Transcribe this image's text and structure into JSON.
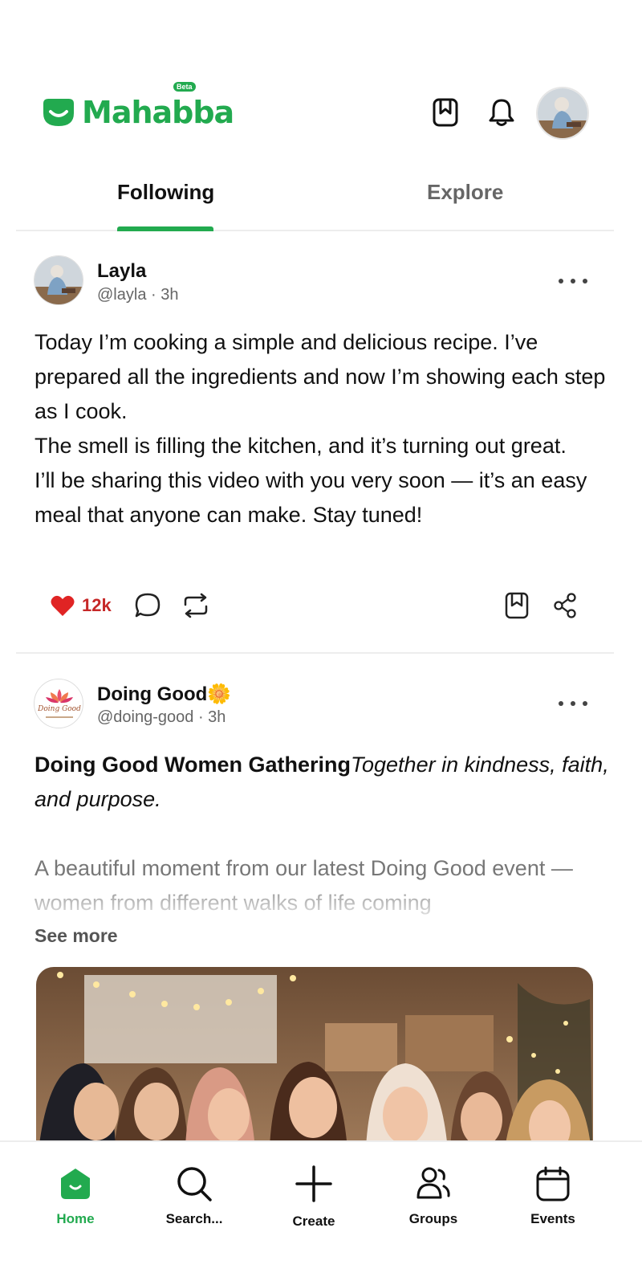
{
  "app": {
    "brand": "Mahabba",
    "badge": "Beta",
    "accent_color": "#22aa4f"
  },
  "header": {
    "icons": [
      "bookmark-icon",
      "bell-icon",
      "profile-avatar"
    ]
  },
  "tabs": [
    {
      "label": "Following",
      "active": true
    },
    {
      "label": "Explore",
      "active": false
    }
  ],
  "posts": [
    {
      "name": "Layla",
      "handle": "@layla",
      "time": "3h",
      "paragraphs": [
        "Today I’m cooking a simple and delicious recipe. I’ve prepared all the ingredients and now I’m showing each step as I cook.",
        "The smell is filling the kitchen, and it’s turning out great.",
        "I’ll be sharing this video with you very soon — it’s an easy meal that anyone can make. Stay tuned!"
      ],
      "likes": "12k",
      "liked": true
    },
    {
      "name": "Doing Good🌼",
      "handle": "@doing-good",
      "time": "3h",
      "avatar_text": "Doing Good",
      "title": "Doing Good Women Gathering",
      "tagline": "Together in kindness, faith, and purpose.",
      "excerpt": "A beautiful moment from our latest Doing Good event — women from different walks of life coming",
      "see_more": "See more"
    }
  ],
  "bottom_nav": [
    {
      "label": "Home",
      "icon": "home-icon",
      "active": true
    },
    {
      "label": "Search...",
      "icon": "search-icon",
      "active": false
    },
    {
      "label": "Create",
      "icon": "plus-icon",
      "active": false
    },
    {
      "label": "Groups",
      "icon": "groups-icon",
      "active": false
    },
    {
      "label": "Events",
      "icon": "calendar-icon",
      "active": false
    }
  ]
}
